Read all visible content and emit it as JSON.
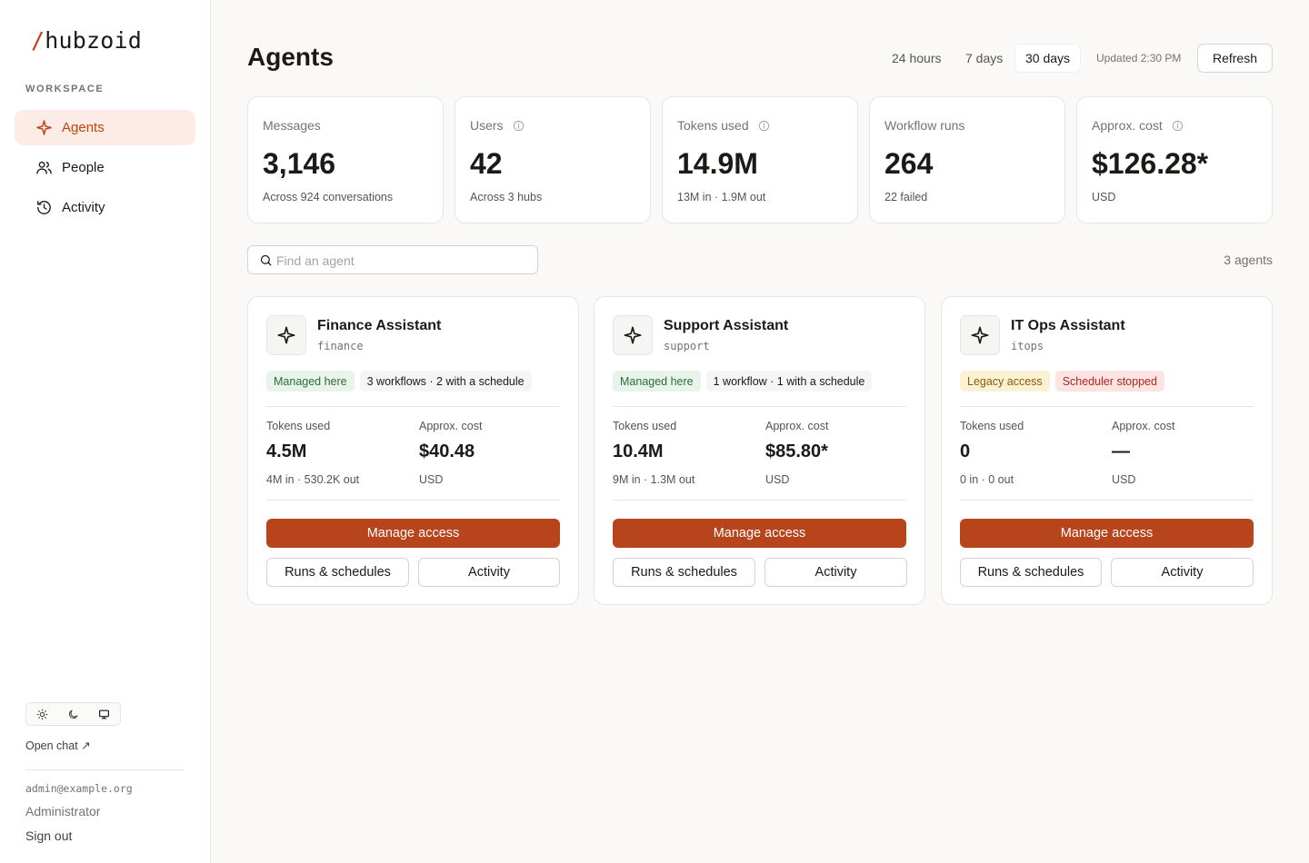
{
  "brand": {
    "slash": "/",
    "name": "hubzoid",
    "accent": "#c2410c"
  },
  "sidebar": {
    "section_label": "WORKSPACE",
    "items": [
      {
        "label": "Agents",
        "icon": "sparkle-icon",
        "active": true
      },
      {
        "label": "People",
        "icon": "users-icon",
        "active": false
      },
      {
        "label": "Activity",
        "icon": "history-icon",
        "active": false
      }
    ],
    "theme_options": [
      "sun-icon",
      "moon-icon",
      "monitor-icon"
    ],
    "open_chat": "Open chat ↗",
    "user": {
      "email": "admin@example.org",
      "role": "Administrator",
      "sign_out": "Sign out"
    }
  },
  "header": {
    "title": "Agents",
    "ranges": [
      "24 hours",
      "7 days",
      "30 days"
    ],
    "active_range": "30 days",
    "updated": "Updated 2:30 PM",
    "refresh": "Refresh"
  },
  "stats": [
    {
      "label": "Messages",
      "value": "3,146",
      "sub": "Across 924 conversations",
      "info": false
    },
    {
      "label": "Users",
      "value": "42",
      "sub": "Across 3 hubs",
      "info": true
    },
    {
      "label": "Tokens used",
      "value": "14.9M",
      "sub": "13M in · 1.9M out",
      "info": true
    },
    {
      "label": "Workflow runs",
      "value": "264",
      "sub": "22 failed",
      "info": false
    },
    {
      "label": "Approx. cost",
      "value": "$126.28*",
      "sub": "USD",
      "info": true
    }
  ],
  "search": {
    "placeholder": "Find an agent",
    "value": ""
  },
  "agent_count": "3 agents",
  "agents": [
    {
      "name": "Finance Assistant",
      "slug": "finance",
      "badges": [
        {
          "text": "Managed here",
          "tone": "green"
        },
        {
          "text": "3 workflows · 2 with a schedule",
          "tone": "neutral"
        }
      ],
      "tokens_label": "Tokens used",
      "tokens": "4.5M",
      "tokens_sub": "4M in · 530.2K out",
      "cost_label": "Approx. cost",
      "cost": "$40.48",
      "cost_sub": "USD",
      "manage": "Manage access",
      "runs": "Runs & schedules",
      "activity": "Activity"
    },
    {
      "name": "Support Assistant",
      "slug": "support",
      "badges": [
        {
          "text": "Managed here",
          "tone": "green"
        },
        {
          "text": "1 workflow · 1 with a schedule",
          "tone": "neutral"
        }
      ],
      "tokens_label": "Tokens used",
      "tokens": "10.4M",
      "tokens_sub": "9M in · 1.3M out",
      "cost_label": "Approx. cost",
      "cost": "$85.80*",
      "cost_sub": "USD",
      "manage": "Manage access",
      "runs": "Runs & schedules",
      "activity": "Activity"
    },
    {
      "name": "IT Ops Assistant",
      "slug": "itops",
      "badges": [
        {
          "text": "Legacy access",
          "tone": "amber"
        },
        {
          "text": "Scheduler stopped",
          "tone": "red"
        }
      ],
      "tokens_label": "Tokens used",
      "tokens": "0",
      "tokens_sub": "0 in · 0 out",
      "cost_label": "Approx. cost",
      "cost": "—",
      "cost_sub": "USD",
      "manage": "Manage access",
      "runs": "Runs & schedules",
      "activity": "Activity"
    }
  ]
}
